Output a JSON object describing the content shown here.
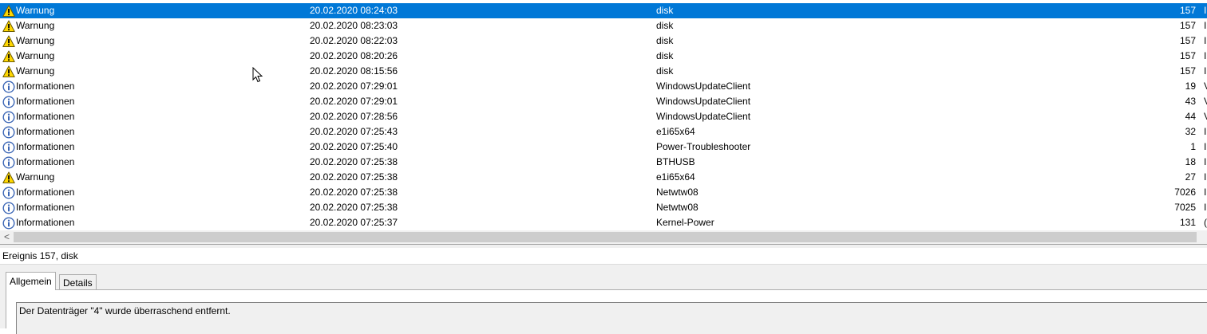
{
  "events": [
    {
      "level": "Warnung",
      "icon": "warning-icon",
      "date": "20.02.2020 08:24:03",
      "source": "disk",
      "id": "157",
      "extra": "I",
      "selected": true
    },
    {
      "level": "Warnung",
      "icon": "warning-icon",
      "date": "20.02.2020 08:23:03",
      "source": "disk",
      "id": "157",
      "extra": "I"
    },
    {
      "level": "Warnung",
      "icon": "warning-icon",
      "date": "20.02.2020 08:22:03",
      "source": "disk",
      "id": "157",
      "extra": "I"
    },
    {
      "level": "Warnung",
      "icon": "warning-icon",
      "date": "20.02.2020 08:20:26",
      "source": "disk",
      "id": "157",
      "extra": "I"
    },
    {
      "level": "Warnung",
      "icon": "warning-icon",
      "date": "20.02.2020 08:15:56",
      "source": "disk",
      "id": "157",
      "extra": "I"
    },
    {
      "level": "Informationen",
      "icon": "info-icon",
      "date": "20.02.2020 07:29:01",
      "source": "WindowsUpdateClient",
      "id": "19",
      "extra": "V"
    },
    {
      "level": "Informationen",
      "icon": "info-icon",
      "date": "20.02.2020 07:29:01",
      "source": "WindowsUpdateClient",
      "id": "43",
      "extra": "V"
    },
    {
      "level": "Informationen",
      "icon": "info-icon",
      "date": "20.02.2020 07:28:56",
      "source": "WindowsUpdateClient",
      "id": "44",
      "extra": "V"
    },
    {
      "level": "Informationen",
      "icon": "info-icon",
      "date": "20.02.2020 07:25:43",
      "source": "e1i65x64",
      "id": "32",
      "extra": "I"
    },
    {
      "level": "Informationen",
      "icon": "info-icon",
      "date": "20.02.2020 07:25:40",
      "source": "Power-Troubleshooter",
      "id": "1",
      "extra": "I"
    },
    {
      "level": "Informationen",
      "icon": "info-icon",
      "date": "20.02.2020 07:25:38",
      "source": "BTHUSB",
      "id": "18",
      "extra": "I"
    },
    {
      "level": "Warnung",
      "icon": "warning-icon",
      "date": "20.02.2020 07:25:38",
      "source": "e1i65x64",
      "id": "27",
      "extra": "I"
    },
    {
      "level": "Informationen",
      "icon": "info-icon",
      "date": "20.02.2020 07:25:38",
      "source": "Netwtw08",
      "id": "7026",
      "extra": "I"
    },
    {
      "level": "Informationen",
      "icon": "info-icon",
      "date": "20.02.2020 07:25:38",
      "source": "Netwtw08",
      "id": "7025",
      "extra": "I"
    },
    {
      "level": "Informationen",
      "icon": "info-icon",
      "date": "20.02.2020 07:25:37",
      "source": "Kernel-Power",
      "id": "131",
      "extra": "("
    }
  ],
  "scrollbar": {
    "left_arrow": "<"
  },
  "detail": {
    "title": "Ereignis 157, disk",
    "tabs": [
      "Allgemein",
      "Details"
    ],
    "message": "Der Datenträger \"4\" wurde überraschend entfernt."
  },
  "colors": {
    "selection": "#0078d7",
    "warning": "#ffd700",
    "info": "#3a65b5"
  }
}
